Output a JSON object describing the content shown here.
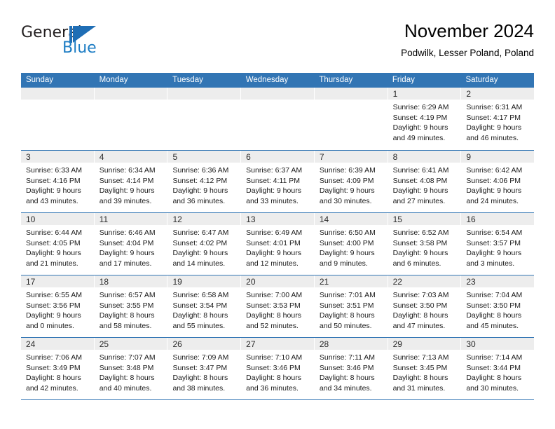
{
  "logo": {
    "word_one": "General",
    "word_two": "Blue",
    "mark": "triangle-flag",
    "color_text": "#231f20",
    "color_accent": "#1d7dc4"
  },
  "header": {
    "title": "November 2024",
    "subtitle": "Podwilk, Lesser Poland, Poland"
  },
  "theme": {
    "header_blue": "#3275b4",
    "band_gray": "#ededed",
    "text": "#1a1a1a"
  },
  "calendar": {
    "weekday_headers": [
      "Sunday",
      "Monday",
      "Tuesday",
      "Wednesday",
      "Thursday",
      "Friday",
      "Saturday"
    ],
    "weeks": [
      [
        {
          "day": "",
          "empty": true,
          "lines": []
        },
        {
          "day": "",
          "empty": true,
          "lines": []
        },
        {
          "day": "",
          "empty": true,
          "lines": []
        },
        {
          "day": "",
          "empty": true,
          "lines": []
        },
        {
          "day": "",
          "empty": true,
          "lines": []
        },
        {
          "day": "1",
          "empty": false,
          "lines": [
            "Sunrise: 6:29 AM",
            "Sunset: 4:19 PM",
            "Daylight: 9 hours",
            "and 49 minutes."
          ]
        },
        {
          "day": "2",
          "empty": false,
          "lines": [
            "Sunrise: 6:31 AM",
            "Sunset: 4:17 PM",
            "Daylight: 9 hours",
            "and 46 minutes."
          ]
        }
      ],
      [
        {
          "day": "3",
          "empty": false,
          "lines": [
            "Sunrise: 6:33 AM",
            "Sunset: 4:16 PM",
            "Daylight: 9 hours",
            "and 43 minutes."
          ]
        },
        {
          "day": "4",
          "empty": false,
          "lines": [
            "Sunrise: 6:34 AM",
            "Sunset: 4:14 PM",
            "Daylight: 9 hours",
            "and 39 minutes."
          ]
        },
        {
          "day": "5",
          "empty": false,
          "lines": [
            "Sunrise: 6:36 AM",
            "Sunset: 4:12 PM",
            "Daylight: 9 hours",
            "and 36 minutes."
          ]
        },
        {
          "day": "6",
          "empty": false,
          "lines": [
            "Sunrise: 6:37 AM",
            "Sunset: 4:11 PM",
            "Daylight: 9 hours",
            "and 33 minutes."
          ]
        },
        {
          "day": "7",
          "empty": false,
          "lines": [
            "Sunrise: 6:39 AM",
            "Sunset: 4:09 PM",
            "Daylight: 9 hours",
            "and 30 minutes."
          ]
        },
        {
          "day": "8",
          "empty": false,
          "lines": [
            "Sunrise: 6:41 AM",
            "Sunset: 4:08 PM",
            "Daylight: 9 hours",
            "and 27 minutes."
          ]
        },
        {
          "day": "9",
          "empty": false,
          "lines": [
            "Sunrise: 6:42 AM",
            "Sunset: 4:06 PM",
            "Daylight: 9 hours",
            "and 24 minutes."
          ]
        }
      ],
      [
        {
          "day": "10",
          "empty": false,
          "lines": [
            "Sunrise: 6:44 AM",
            "Sunset: 4:05 PM",
            "Daylight: 9 hours",
            "and 21 minutes."
          ]
        },
        {
          "day": "11",
          "empty": false,
          "lines": [
            "Sunrise: 6:46 AM",
            "Sunset: 4:04 PM",
            "Daylight: 9 hours",
            "and 17 minutes."
          ]
        },
        {
          "day": "12",
          "empty": false,
          "lines": [
            "Sunrise: 6:47 AM",
            "Sunset: 4:02 PM",
            "Daylight: 9 hours",
            "and 14 minutes."
          ]
        },
        {
          "day": "13",
          "empty": false,
          "lines": [
            "Sunrise: 6:49 AM",
            "Sunset: 4:01 PM",
            "Daylight: 9 hours",
            "and 12 minutes."
          ]
        },
        {
          "day": "14",
          "empty": false,
          "lines": [
            "Sunrise: 6:50 AM",
            "Sunset: 4:00 PM",
            "Daylight: 9 hours",
            "and 9 minutes."
          ]
        },
        {
          "day": "15",
          "empty": false,
          "lines": [
            "Sunrise: 6:52 AM",
            "Sunset: 3:58 PM",
            "Daylight: 9 hours",
            "and 6 minutes."
          ]
        },
        {
          "day": "16",
          "empty": false,
          "lines": [
            "Sunrise: 6:54 AM",
            "Sunset: 3:57 PM",
            "Daylight: 9 hours",
            "and 3 minutes."
          ]
        }
      ],
      [
        {
          "day": "17",
          "empty": false,
          "lines": [
            "Sunrise: 6:55 AM",
            "Sunset: 3:56 PM",
            "Daylight: 9 hours",
            "and 0 minutes."
          ]
        },
        {
          "day": "18",
          "empty": false,
          "lines": [
            "Sunrise: 6:57 AM",
            "Sunset: 3:55 PM",
            "Daylight: 8 hours",
            "and 58 minutes."
          ]
        },
        {
          "day": "19",
          "empty": false,
          "lines": [
            "Sunrise: 6:58 AM",
            "Sunset: 3:54 PM",
            "Daylight: 8 hours",
            "and 55 minutes."
          ]
        },
        {
          "day": "20",
          "empty": false,
          "lines": [
            "Sunrise: 7:00 AM",
            "Sunset: 3:53 PM",
            "Daylight: 8 hours",
            "and 52 minutes."
          ]
        },
        {
          "day": "21",
          "empty": false,
          "lines": [
            "Sunrise: 7:01 AM",
            "Sunset: 3:51 PM",
            "Daylight: 8 hours",
            "and 50 minutes."
          ]
        },
        {
          "day": "22",
          "empty": false,
          "lines": [
            "Sunrise: 7:03 AM",
            "Sunset: 3:50 PM",
            "Daylight: 8 hours",
            "and 47 minutes."
          ]
        },
        {
          "day": "23",
          "empty": false,
          "lines": [
            "Sunrise: 7:04 AM",
            "Sunset: 3:50 PM",
            "Daylight: 8 hours",
            "and 45 minutes."
          ]
        }
      ],
      [
        {
          "day": "24",
          "empty": false,
          "lines": [
            "Sunrise: 7:06 AM",
            "Sunset: 3:49 PM",
            "Daylight: 8 hours",
            "and 42 minutes."
          ]
        },
        {
          "day": "25",
          "empty": false,
          "lines": [
            "Sunrise: 7:07 AM",
            "Sunset: 3:48 PM",
            "Daylight: 8 hours",
            "and 40 minutes."
          ]
        },
        {
          "day": "26",
          "empty": false,
          "lines": [
            "Sunrise: 7:09 AM",
            "Sunset: 3:47 PM",
            "Daylight: 8 hours",
            "and 38 minutes."
          ]
        },
        {
          "day": "27",
          "empty": false,
          "lines": [
            "Sunrise: 7:10 AM",
            "Sunset: 3:46 PM",
            "Daylight: 8 hours",
            "and 36 minutes."
          ]
        },
        {
          "day": "28",
          "empty": false,
          "lines": [
            "Sunrise: 7:11 AM",
            "Sunset: 3:46 PM",
            "Daylight: 8 hours",
            "and 34 minutes."
          ]
        },
        {
          "day": "29",
          "empty": false,
          "lines": [
            "Sunrise: 7:13 AM",
            "Sunset: 3:45 PM",
            "Daylight: 8 hours",
            "and 31 minutes."
          ]
        },
        {
          "day": "30",
          "empty": false,
          "lines": [
            "Sunrise: 7:14 AM",
            "Sunset: 3:44 PM",
            "Daylight: 8 hours",
            "and 30 minutes."
          ]
        }
      ]
    ]
  }
}
